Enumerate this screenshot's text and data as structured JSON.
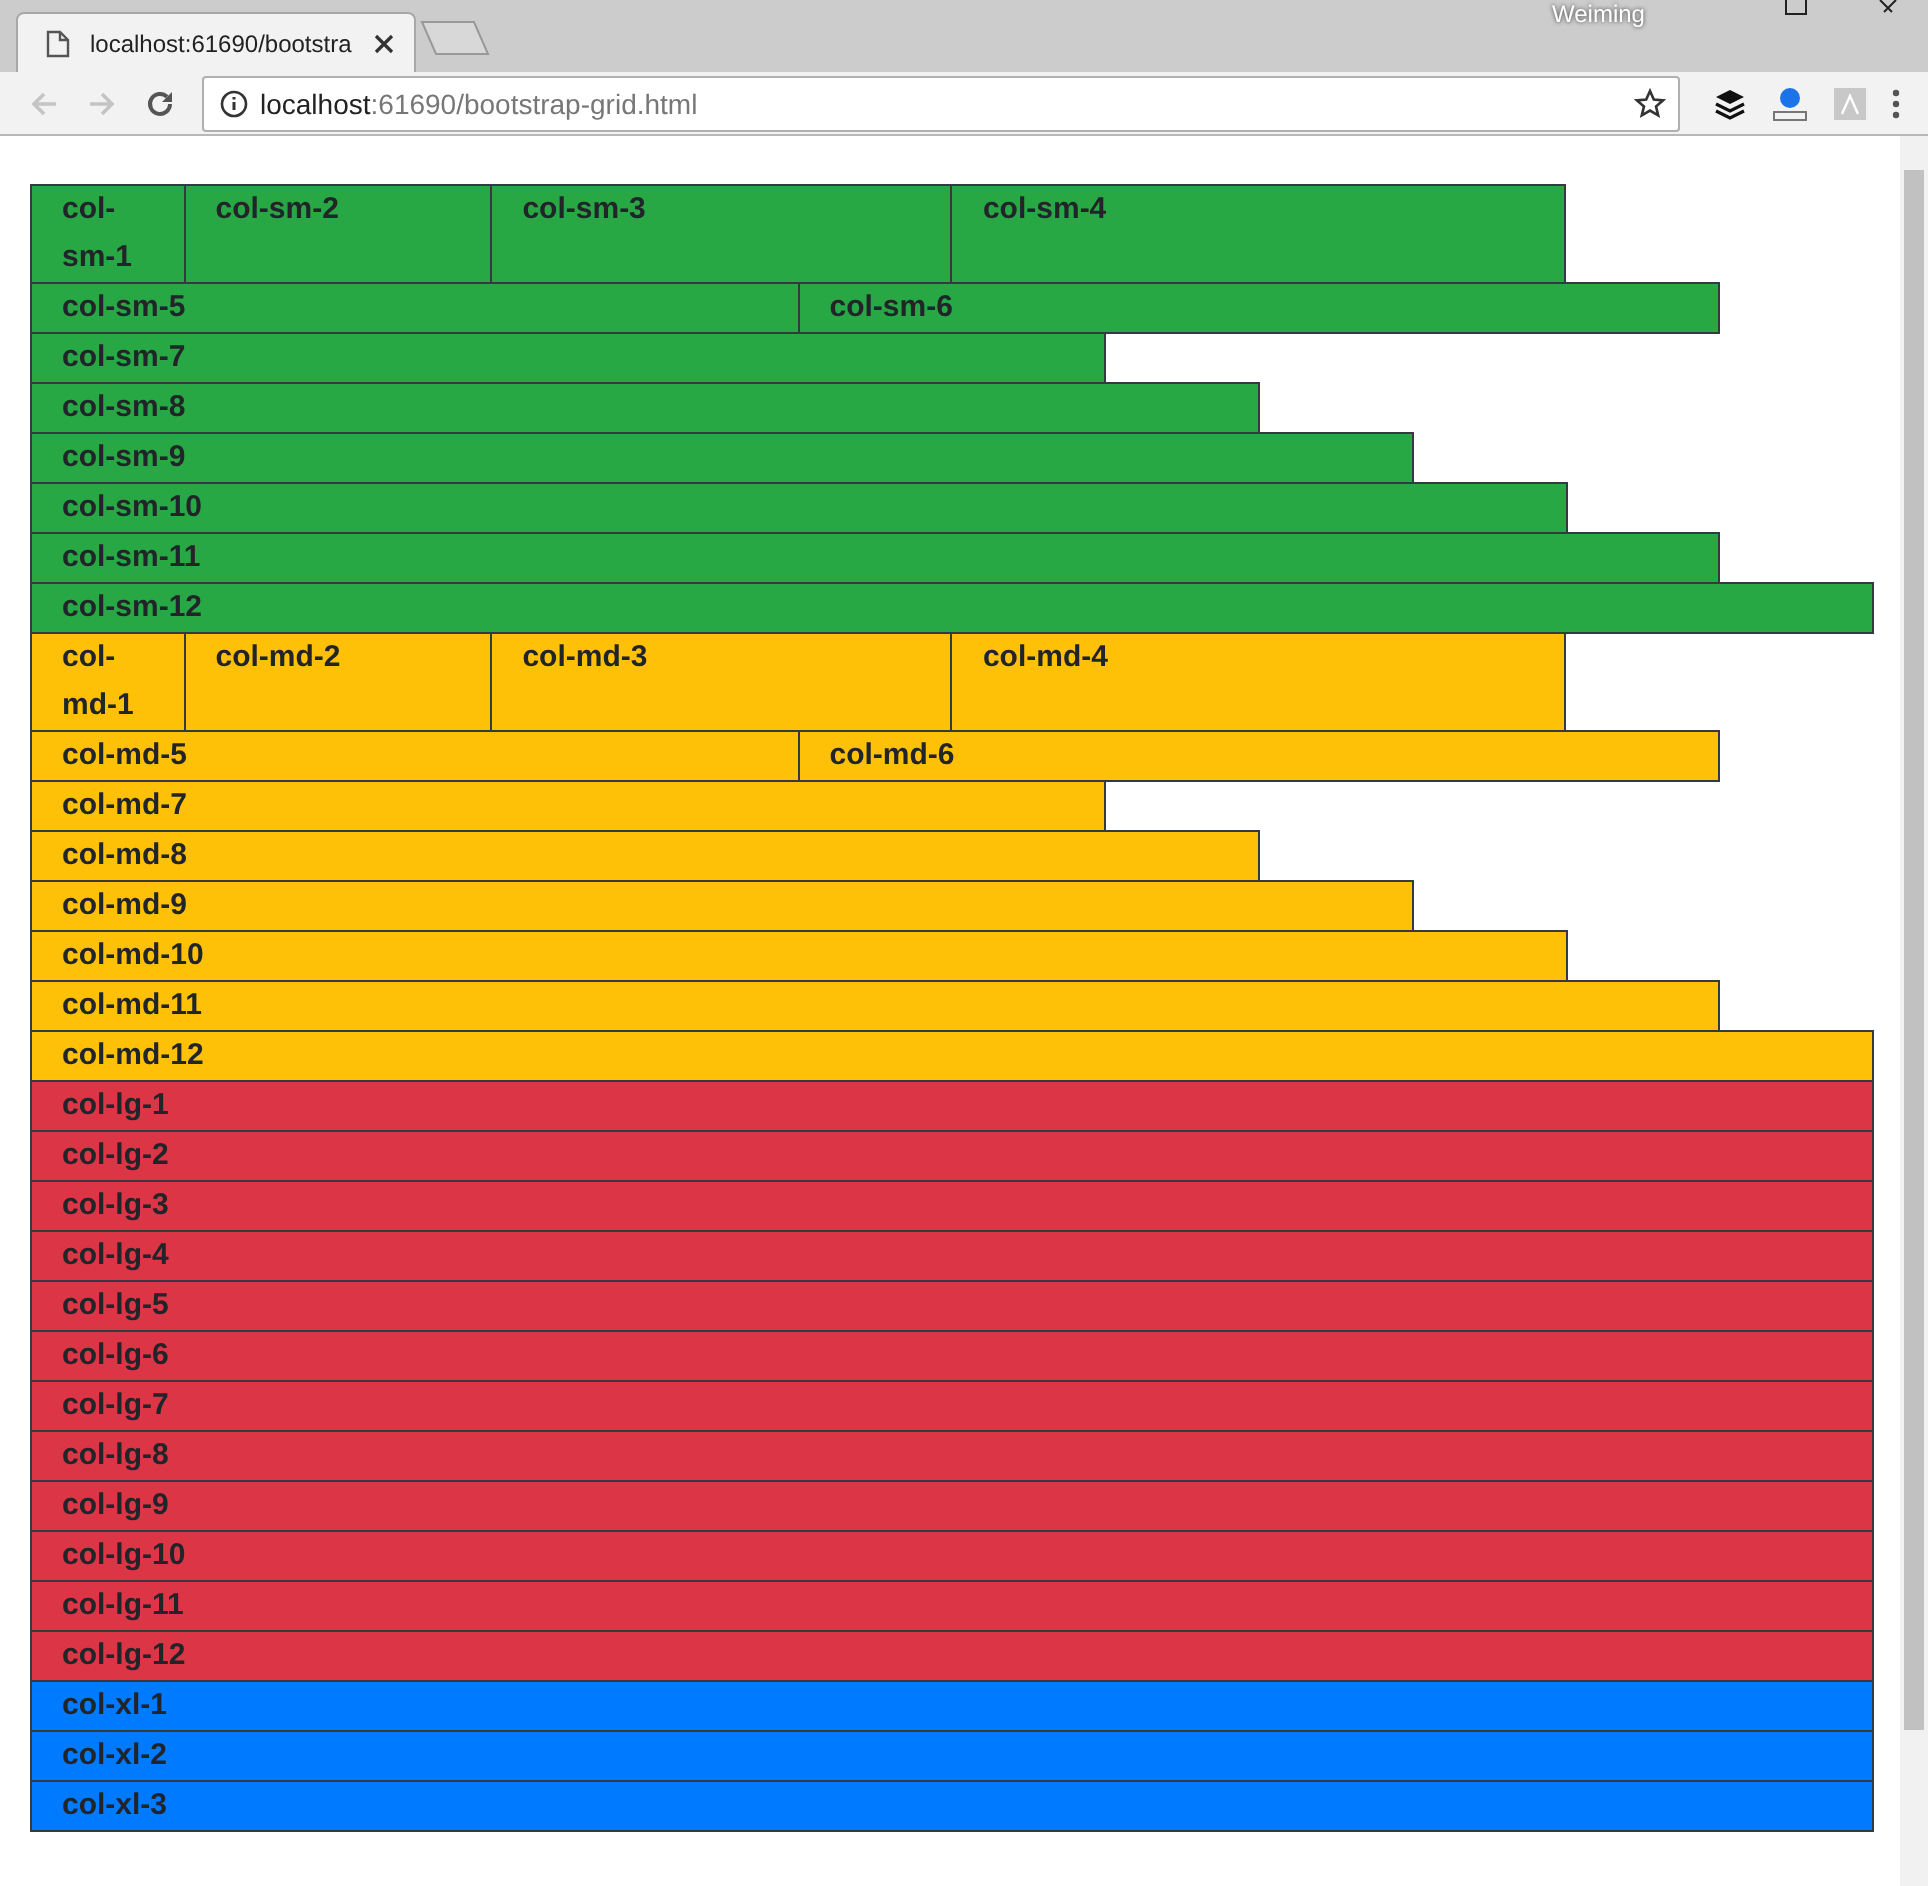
{
  "browser": {
    "tab_title": "localhost:61690/bootstra",
    "profile_name": "Weiming",
    "url_host": "localhost",
    "url_rest": ":61690/bootstrap-grid.html"
  },
  "groups": [
    {
      "kind": "graded",
      "color": "#28a745",
      "rows": [
        [
          {
            "label": "col-sm-1"
          },
          {
            "label": "col-sm-2"
          },
          {
            "label": "col-sm-3"
          },
          {
            "label": "col-sm-4"
          }
        ],
        [
          {
            "label": "col-sm-5"
          },
          {
            "label": "col-sm-6"
          }
        ],
        [
          {
            "label": "col-sm-7"
          }
        ],
        [
          {
            "label": "col-sm-8"
          }
        ],
        [
          {
            "label": "col-sm-9"
          }
        ],
        [
          {
            "label": "col-sm-10"
          }
        ],
        [
          {
            "label": "col-sm-11"
          }
        ],
        [
          {
            "label": "col-sm-12"
          }
        ]
      ]
    },
    {
      "kind": "graded",
      "color": "#ffc107",
      "rows": [
        [
          {
            "label": "col-md-1"
          },
          {
            "label": "col-md-2"
          },
          {
            "label": "col-md-3"
          },
          {
            "label": "col-md-4"
          }
        ],
        [
          {
            "label": "col-md-5"
          },
          {
            "label": "col-md-6"
          }
        ],
        [
          {
            "label": "col-md-7"
          }
        ],
        [
          {
            "label": "col-md-8"
          }
        ],
        [
          {
            "label": "col-md-9"
          }
        ],
        [
          {
            "label": "col-md-10"
          }
        ],
        [
          {
            "label": "col-md-11"
          }
        ],
        [
          {
            "label": "col-md-12"
          }
        ]
      ]
    },
    {
      "kind": "stacked",
      "color": "#dc3545",
      "rows": [
        [
          {
            "label": "col-lg-1"
          }
        ],
        [
          {
            "label": "col-lg-2"
          }
        ],
        [
          {
            "label": "col-lg-3"
          }
        ],
        [
          {
            "label": "col-lg-4"
          }
        ],
        [
          {
            "label": "col-lg-5"
          }
        ],
        [
          {
            "label": "col-lg-6"
          }
        ],
        [
          {
            "label": "col-lg-7"
          }
        ],
        [
          {
            "label": "col-lg-8"
          }
        ],
        [
          {
            "label": "col-lg-9"
          }
        ],
        [
          {
            "label": "col-lg-10"
          }
        ],
        [
          {
            "label": "col-lg-11"
          }
        ],
        [
          {
            "label": "col-lg-12"
          }
        ]
      ]
    },
    {
      "kind": "stacked",
      "color": "#007bff",
      "rows": [
        [
          {
            "label": "col-xl-1"
          }
        ],
        [
          {
            "label": "col-xl-2"
          }
        ],
        [
          {
            "label": "col-xl-3"
          }
        ]
      ]
    }
  ]
}
